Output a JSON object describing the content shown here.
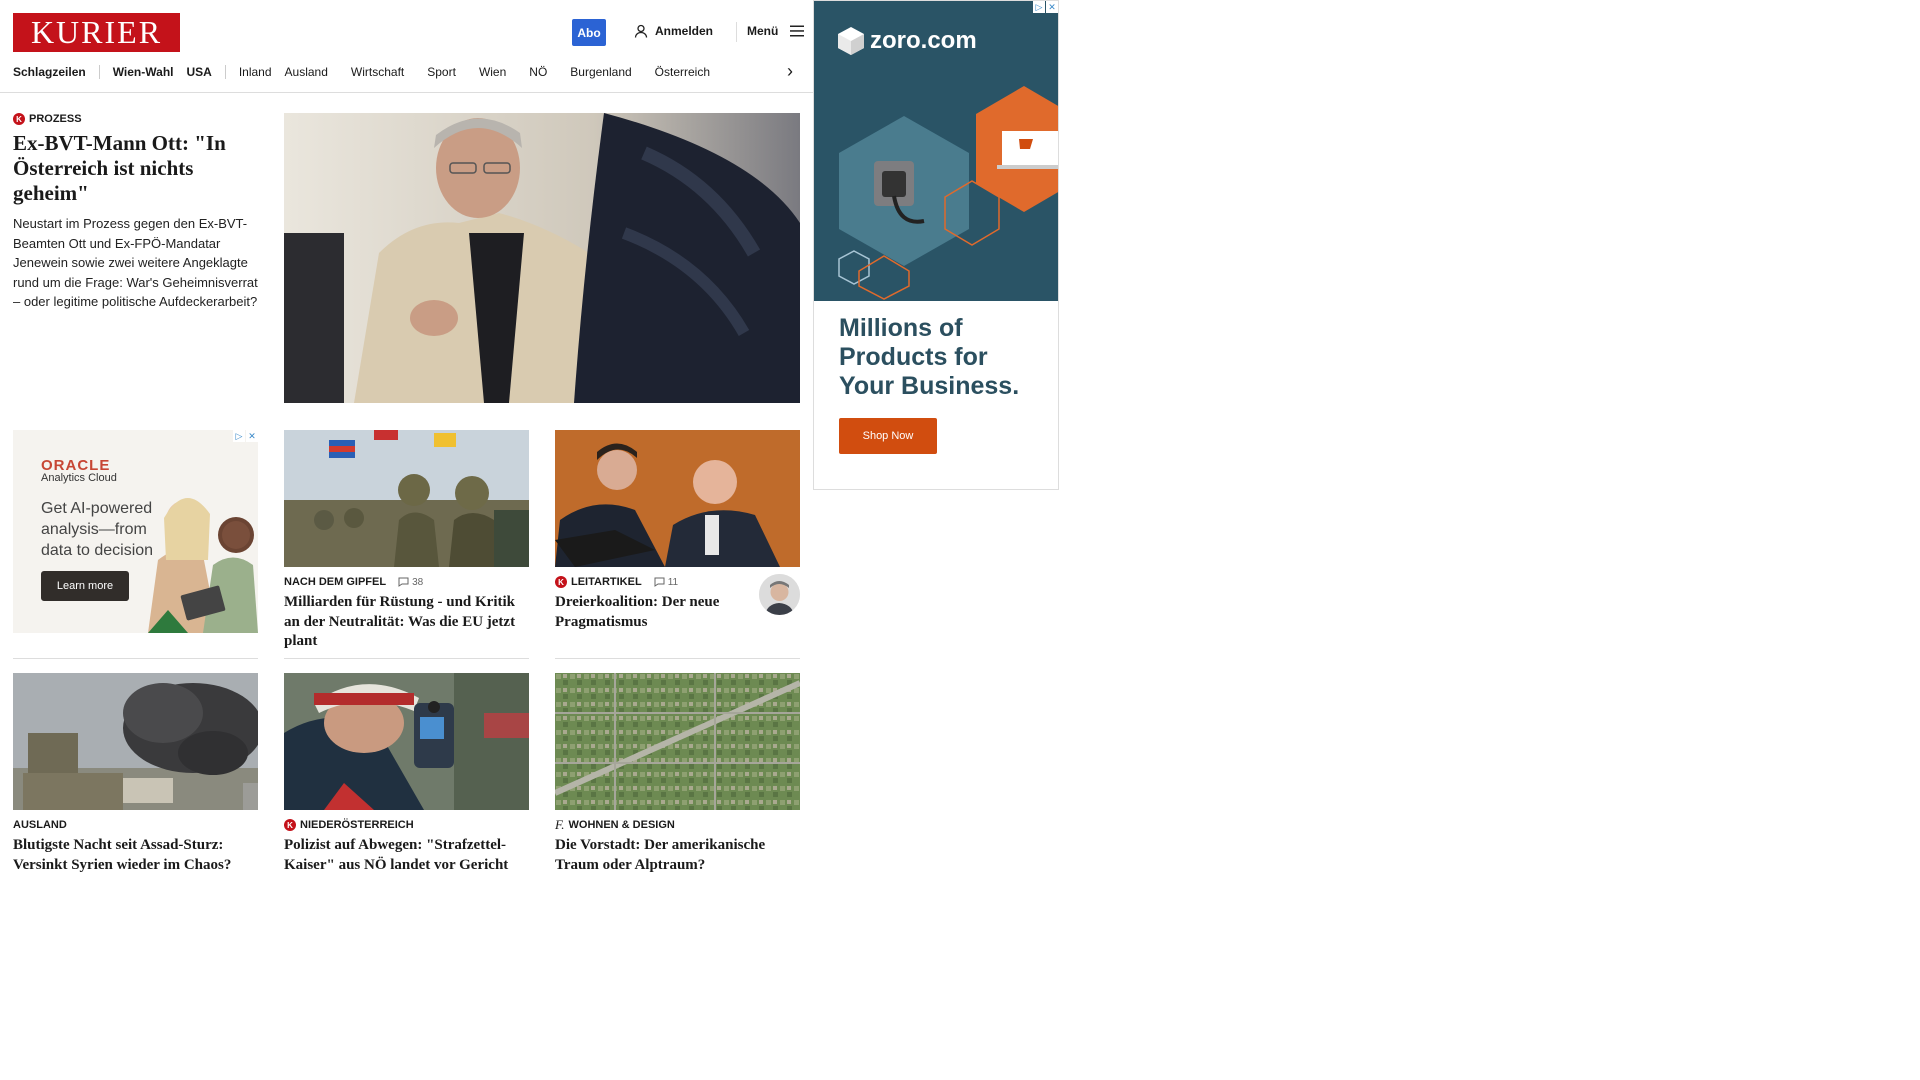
{
  "header": {
    "logo_text": "KURIER",
    "abo_label": "Abo",
    "login_label": "Anmelden",
    "menu_label": "Menü",
    "nav": [
      {
        "label": "Schlagzeilen",
        "bold": true
      },
      {
        "label": "Wien-Wahl",
        "bold": true
      },
      {
        "label": "USA",
        "bold": true
      },
      {
        "label": "Inland",
        "bold": false
      },
      {
        "label": "Ausland",
        "bold": false
      },
      {
        "label": "Wirtschaft",
        "bold": false
      },
      {
        "label": "Sport",
        "bold": false
      },
      {
        "label": "Wien",
        "bold": false
      },
      {
        "label": "NÖ",
        "bold": false
      },
      {
        "label": "Burgenland",
        "bold": false
      },
      {
        "label": "Österreich",
        "bold": false
      }
    ]
  },
  "hero": {
    "kicker": "PROZESS",
    "title": "Ex-BVT-Mann Ott: \"In Österreich ist nichts geheim\"",
    "teaser": "Neustart im Prozess gegen den Ex-BVT-Beamten Ott und Ex-FPÖ-Mandatar Jenewein sowie zwei weitere Angeklagte rund um die Frage: War's Geheimnisverrat – oder legitime politische Aufdeckerarbeit?"
  },
  "articles": [
    {
      "kicker": "NACH DEM GIPFEL",
      "comments": "38",
      "title": "Milliarden für Rüstung - und Kritik an der Neutralität: Was die EU jetzt plant"
    },
    {
      "kicker": "LEITARTIKEL",
      "comments": "11",
      "title": "Dreierkoalition: Der neue Pragmatismus"
    },
    {
      "kicker": "AUSLAND",
      "title": "Blutigste Nacht seit Assad-Sturz: Versinkt Syrien wieder im Chaos?"
    },
    {
      "kicker": "NIEDERÖSTERREICH",
      "title": "Polizist auf Abwegen: \"Strafzettel-Kaiser\" aus NÖ landet vor Gericht"
    },
    {
      "kicker": "WOHNEN & DESIGN",
      "title": "Die Vorstadt: Der amerikanische Traum oder Alptraum?"
    }
  ],
  "ads": {
    "oracle": {
      "brand": "ORACLE",
      "sub": "Analytics Cloud",
      "headline": "Get AI-powered analysis—from data to decision",
      "button": "Learn more"
    },
    "zoro": {
      "brand": "zoro.com",
      "headline": "Millions of Products for Your Business.",
      "button": "Shop Now"
    }
  },
  "colors": {
    "brand_red": "#c4121a",
    "abo_blue": "#2b63d4",
    "zoro_teal": "#2a5466",
    "zoro_orange": "#d14d0f"
  }
}
